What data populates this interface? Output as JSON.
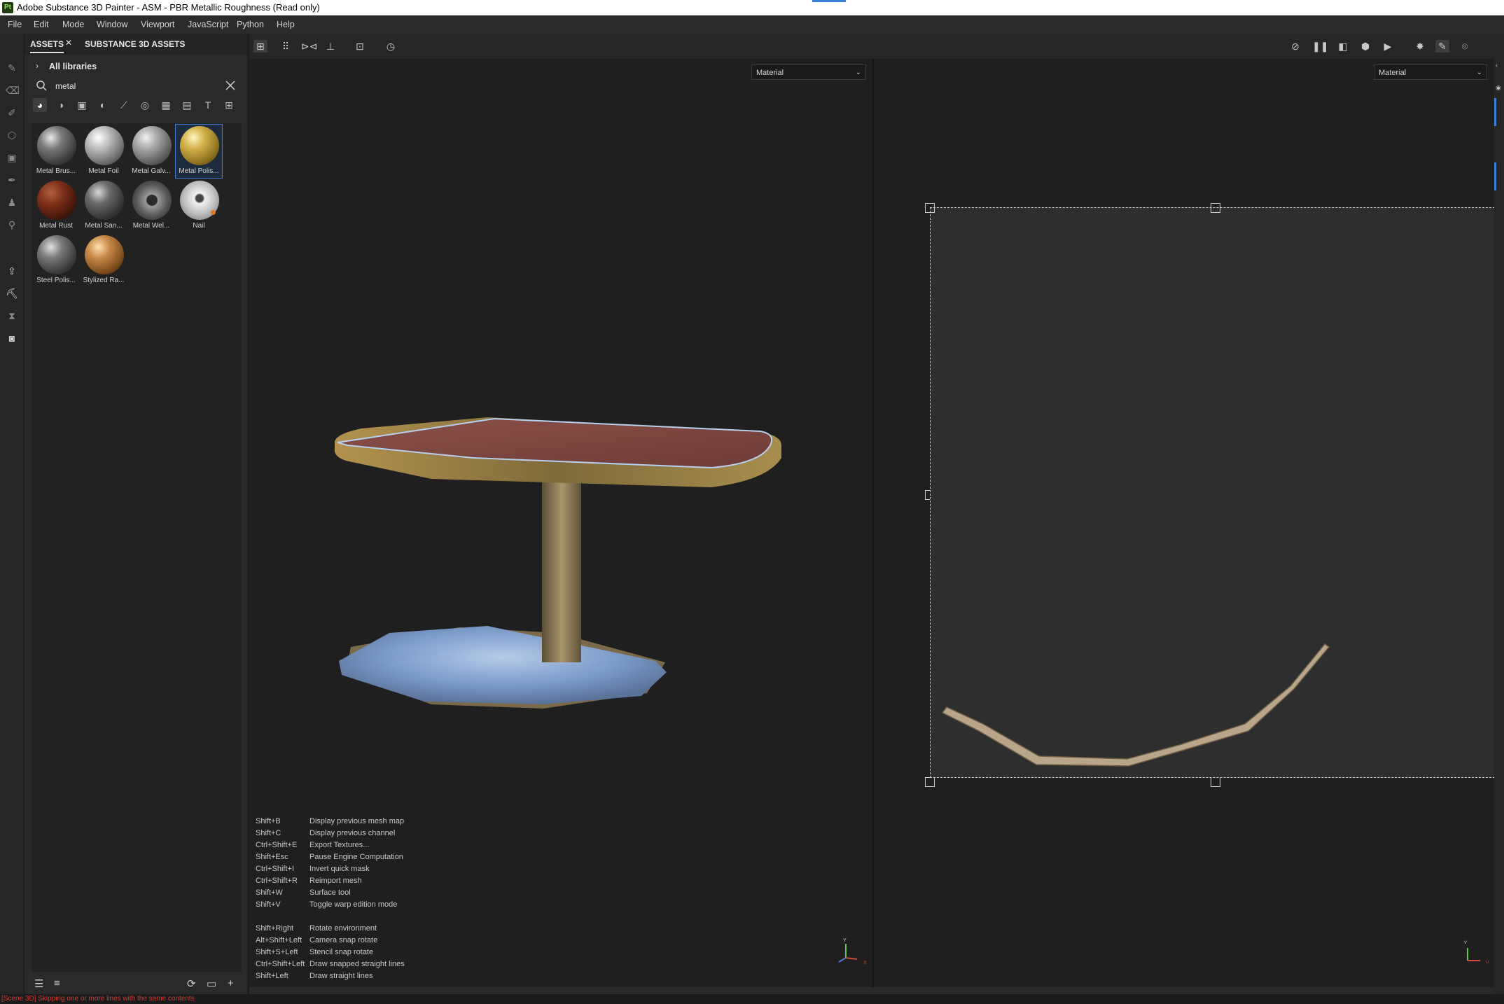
{
  "window": {
    "title": "Adobe Substance 3D Painter - ASM - PBR Metallic Roughness (Read only)",
    "logo": "Pt"
  },
  "menu": [
    "File",
    "Edit",
    "Mode",
    "Window",
    "Viewport",
    "JavaScript",
    "Python",
    "Help"
  ],
  "assets_panel": {
    "tabs": [
      {
        "label": "ASSETS",
        "active": true
      },
      {
        "label": "SUBSTANCE 3D ASSETS",
        "active": false
      }
    ],
    "close_glyph": "✕",
    "breadcrumb": "All libraries",
    "search": {
      "value": "metal"
    },
    "filters": [
      "materials-icon",
      "smart-materials-icon",
      "masks-icon",
      "filters-icon",
      "brushes-icon",
      "particles-icon",
      "alphas-icon",
      "environments-icon",
      "text-icon",
      "all-icon"
    ],
    "items": [
      {
        "label": "Metal Brus...",
        "color": "#6e6e6e",
        "selected": false
      },
      {
        "label": "Metal Foil",
        "color": "#9a9a9a",
        "selected": false
      },
      {
        "label": "Metal Galv...",
        "color": "#8a8a8a",
        "selected": false
      },
      {
        "label": "Metal Polis...",
        "color": "#b89a3a",
        "selected": true
      },
      {
        "label": "Metal Rust",
        "color": "#6a2a1a",
        "selected": false
      },
      {
        "label": "Metal San...",
        "color": "#5a5a5a",
        "selected": false
      },
      {
        "label": "Metal Wel...",
        "color": "#707070",
        "selected": false
      },
      {
        "label": "Nail",
        "color": "#c8c8c8",
        "selected": false
      },
      {
        "label": "Steel Polis...",
        "color": "#5e5e5e",
        "selected": false
      },
      {
        "label": "Stylized Ra...",
        "color": "#b07a3a",
        "selected": false
      }
    ]
  },
  "viewport": {
    "left_mode": "Material",
    "right_mode": "Material",
    "shortcuts": [
      {
        "key": "Shift+B",
        "action": "Display previous mesh map"
      },
      {
        "key": "Shift+C",
        "action": "Display previous channel"
      },
      {
        "key": "Ctrl+Shift+E",
        "action": "Export Textures..."
      },
      {
        "key": "Shift+Esc",
        "action": "Pause Engine Computation"
      },
      {
        "key": "Ctrl+Shift+I",
        "action": "Invert quick mask"
      },
      {
        "key": "Ctrl+Shift+R",
        "action": "Reimport mesh"
      },
      {
        "key": "Shift+W",
        "action": "Surface tool"
      },
      {
        "key": "Shift+V",
        "action": "Toggle warp edition mode"
      },
      {
        "key": "Shift+Right",
        "action": "Rotate environment"
      },
      {
        "key": "Alt+Shift+Left",
        "action": "Camera snap rotate"
      },
      {
        "key": "Shift+S+Left",
        "action": "Stencil snap rotate"
      },
      {
        "key": "Ctrl+Shift+Left",
        "action": "Draw snapped straight lines"
      },
      {
        "key": "Shift+Left",
        "action": "Draw straight lines"
      }
    ],
    "gizmo": {
      "y": "Y",
      "x": "X",
      "u": "U",
      "v": "V"
    }
  },
  "status": "[Scene 3D] Skipping one or more lines with the same contents"
}
